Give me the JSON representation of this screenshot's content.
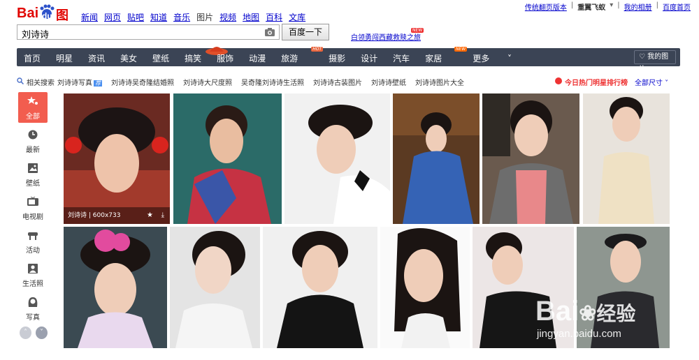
{
  "logo": {
    "bai": "Bai",
    "du": "du",
    "tupian": "图片"
  },
  "nav": [
    "新闻",
    "网页",
    "贴吧",
    "知道",
    "音乐",
    "图片",
    "视频",
    "地图",
    "百科",
    "文库"
  ],
  "nav_current": "图片",
  "toplinks": {
    "classic": "传统翻页版本",
    "user": "重翼飞蚁",
    "album": "我的相册",
    "home": "百度首页"
  },
  "search": {
    "value": "刘诗诗",
    "button": "百度一下"
  },
  "promo": {
    "text": "白领勇闯西藏救赎之旅",
    "badge": "NEW"
  },
  "categories": [
    "首页",
    "明星",
    "资讯",
    "美女",
    "壁纸",
    "搞笑",
    "服饰",
    "动漫",
    "旅游",
    "摄影",
    "设计",
    "汽车",
    "家居",
    "更多"
  ],
  "cat_badges": {
    "hot": "HOT",
    "new": "NEW"
  },
  "my_images": "我的图片",
  "related": {
    "label": "相关搜索",
    "items": [
      "刘诗诗写真",
      "刘诗诗吴奇隆结婚照",
      "刘诗诗大尺度照",
      "吴奇隆刘诗诗生活照",
      "刘诗诗古装图片",
      "刘诗诗壁纸",
      "刘诗诗图片大全"
    ],
    "tag": "荐",
    "rank": "今日热门明星排行榜",
    "size": "全部尺寸"
  },
  "sidebar": [
    "全部",
    "最新",
    "壁纸",
    "电视剧",
    "活动",
    "生活照",
    "写真"
  ],
  "first_caption": {
    "name": "刘诗诗",
    "size": "600x733"
  },
  "watermark": {
    "brand": "Bai",
    "sub": "经验",
    "url": "jingyan.baidu.com"
  },
  "colors": {
    "brand_red": "#e10602",
    "catbar": "#3b4455",
    "active": "#f25d4f"
  }
}
